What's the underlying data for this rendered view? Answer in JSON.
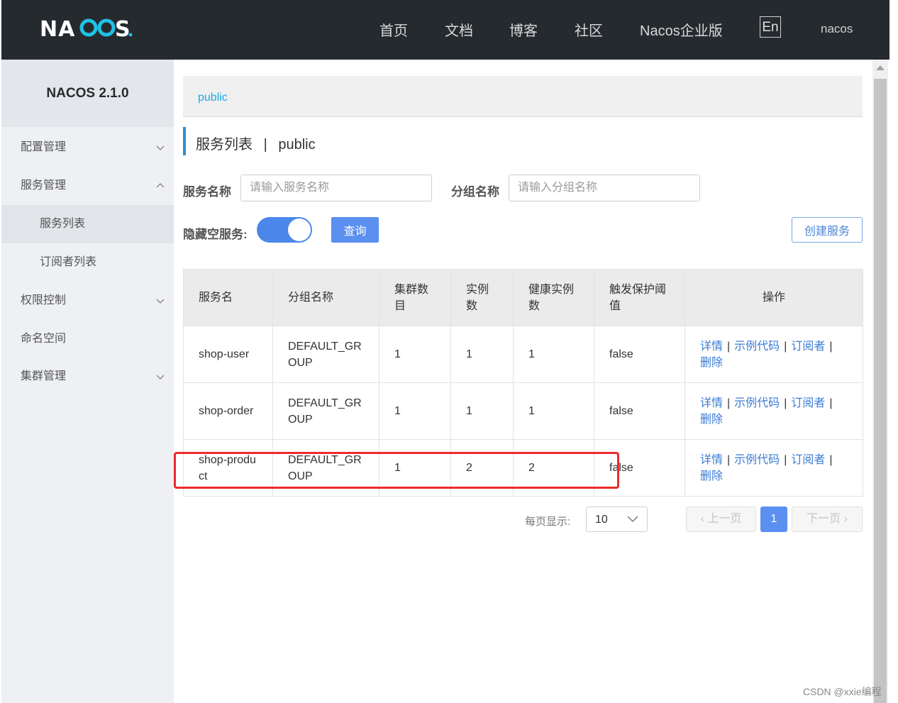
{
  "header": {
    "logo_text": "NACOS.",
    "nav": [
      "首页",
      "文档",
      "博客",
      "社区",
      "Nacos企业版"
    ],
    "lang": "En",
    "user": "nacos"
  },
  "sidebar": {
    "title": "NACOS 2.1.0",
    "items": [
      {
        "label": "配置管理",
        "chevron": "down"
      },
      {
        "label": "服务管理",
        "chevron": "up"
      },
      {
        "label": "服务列表",
        "sub": true,
        "active": true
      },
      {
        "label": "订阅者列表",
        "sub": true
      },
      {
        "label": "权限控制",
        "chevron": "down"
      },
      {
        "label": "命名空间"
      },
      {
        "label": "集群管理",
        "chevron": "down"
      }
    ]
  },
  "breadcrumb": {
    "namespace": "public"
  },
  "page": {
    "title": "服务列表",
    "separator": "|",
    "namespace": "public"
  },
  "filters": {
    "service_label": "服务名称",
    "service_placeholder": "请输入服务名称",
    "group_label": "分组名称",
    "group_placeholder": "请输入分组名称",
    "hide_empty_label": "隐藏空服务:",
    "hide_empty_on": true,
    "query_button": "查询",
    "create_button": "创建服务"
  },
  "table": {
    "columns": [
      "服务名",
      "分组名称",
      "集群数目",
      "实例数",
      "健康实例数",
      "触发保护阈值",
      "操作"
    ],
    "rows": [
      {
        "name": "shop-user",
        "group": "DEFAULT_GROUP",
        "clusters": "1",
        "instances": "1",
        "healthy": "1",
        "protect": "false"
      },
      {
        "name": "shop-order",
        "group": "DEFAULT_GROUP",
        "clusters": "1",
        "instances": "1",
        "healthy": "1",
        "protect": "false"
      },
      {
        "name": "shop-product",
        "group": "DEFAULT_GROUP",
        "clusters": "1",
        "instances": "2",
        "healthy": "2",
        "protect": "false"
      }
    ],
    "actions": {
      "detail": "详情",
      "sample": "示例代码",
      "subscribers": "订阅者",
      "delete": "删除",
      "separator": "|"
    }
  },
  "pagination": {
    "page_size_label": "每页显示:",
    "page_size": "10",
    "prev": "上一页",
    "next": "下一页",
    "current": "1"
  },
  "watermark": "CSDN @xxie编程",
  "colors": {
    "accent": "#5b8ff0",
    "header_bg": "#252a2f",
    "link": "#3a7bd5",
    "highlight": "#ee2a2a"
  }
}
